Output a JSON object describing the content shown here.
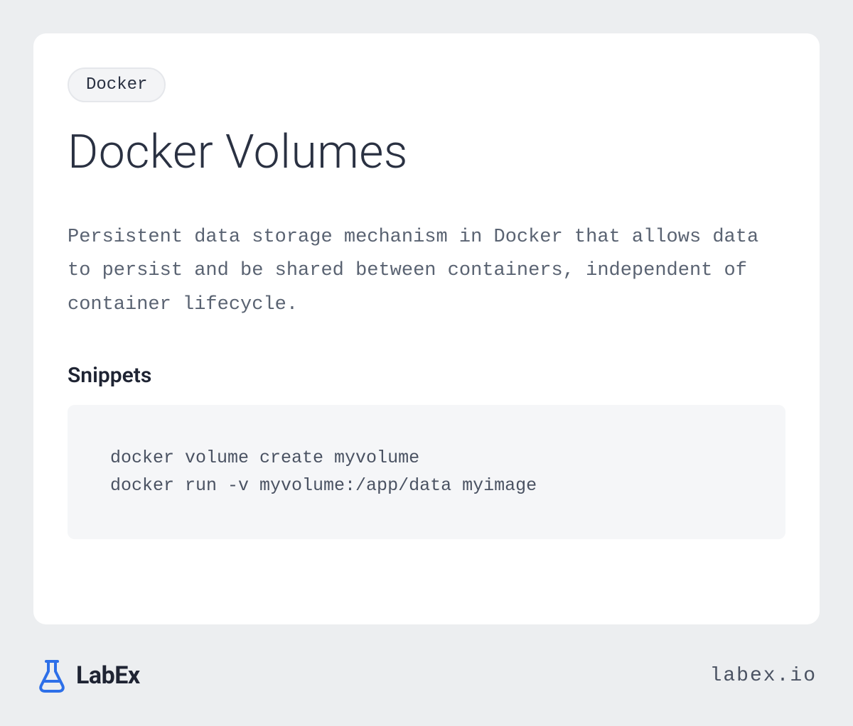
{
  "tag": "Docker",
  "title": "Docker Volumes",
  "description": "Persistent data storage mechanism in Docker that allows data to persist and be shared between containers, independent of container lifecycle.",
  "snippets": {
    "heading": "Snippets",
    "code": "docker volume create myvolume\ndocker run -v myvolume:/app/data myimage"
  },
  "footer": {
    "brand_name": "LabEx",
    "site_url": "labex.io"
  }
}
